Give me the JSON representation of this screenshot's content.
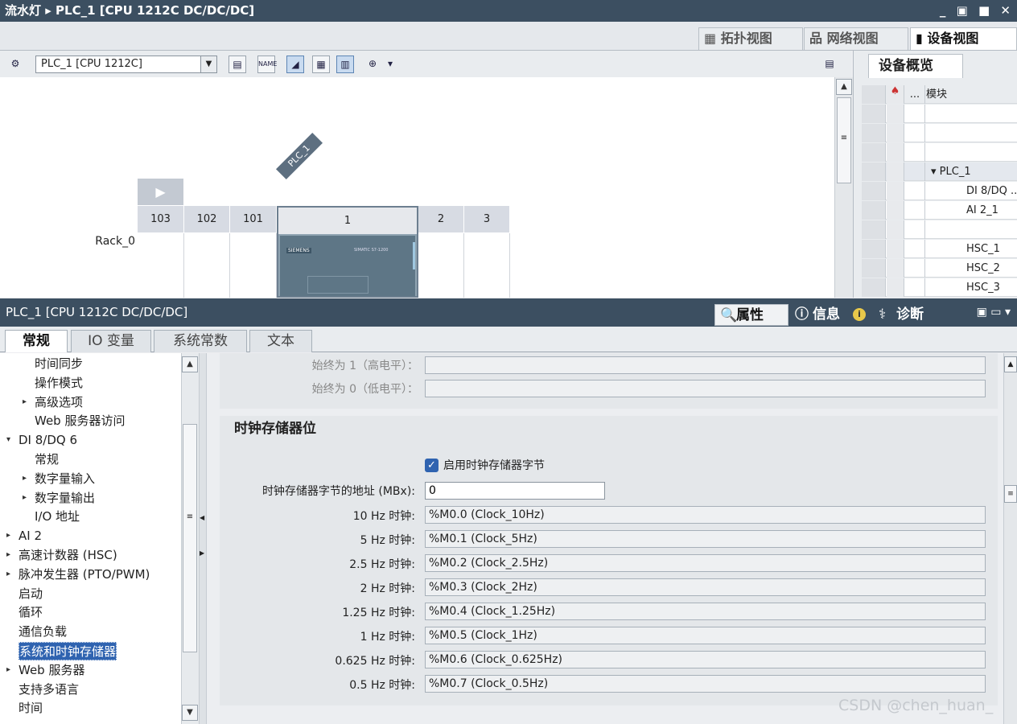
{
  "title_bar": {
    "project": "流水灯",
    "device": "PLC_1 [CPU 1212C DC/DC/DC]",
    "controls": "_ ▣ ■ ✕"
  },
  "view_tabs": [
    {
      "label": "拓扑视图",
      "icon": "topology-icon"
    },
    {
      "label": "网络视图",
      "icon": "network-icon"
    },
    {
      "label": "设备视图",
      "icon": "device-icon",
      "active": true
    }
  ],
  "toolbar": {
    "device_select": "PLC_1 [CPU 1212C]"
  },
  "canvas": {
    "plc_label": "PLC_1",
    "rack_label": "Rack_0",
    "slots": [
      "103",
      "102",
      "101",
      "1",
      "2",
      "3"
    ],
    "brand": "SIEMENS",
    "model": "SIMATIC S7-1200"
  },
  "overview": {
    "tab": "设备概览",
    "col_dots": "...",
    "col_module": "模块",
    "rows": [
      "",
      "",
      "",
      "PLC_1",
      "DI 8/DQ ...",
      "AI 2_1",
      "",
      "HSC_1",
      "HSC_2",
      "HSC_3"
    ]
  },
  "properties_bar": {
    "title": "PLC_1 [CPU 1212C DC/DC/DC]",
    "tabs": [
      {
        "label": "属性",
        "icon": "properties-icon"
      },
      {
        "label": "信息",
        "icon": "info-icon"
      },
      {
        "label": "诊断",
        "icon": "diagnostics-icon"
      }
    ],
    "info_badge": "i"
  },
  "sub_tabs": [
    "常规",
    "IO 变量",
    "系统常数",
    "文本"
  ],
  "nav": {
    "items": [
      {
        "label": "时间同步",
        "indent": 2,
        "expand": ""
      },
      {
        "label": "操作模式",
        "indent": 2,
        "expand": ""
      },
      {
        "label": "高级选项",
        "indent": 2,
        "expand": "▸"
      },
      {
        "label": "Web 服务器访问",
        "indent": 2,
        "expand": ""
      },
      {
        "label": "DI 8/DQ 6",
        "indent": 1,
        "expand": "▾"
      },
      {
        "label": "常规",
        "indent": 2,
        "expand": ""
      },
      {
        "label": "数字量输入",
        "indent": 2,
        "expand": "▸"
      },
      {
        "label": "数字量输出",
        "indent": 2,
        "expand": "▸"
      },
      {
        "label": "I/O 地址",
        "indent": 2,
        "expand": ""
      },
      {
        "label": "AI 2",
        "indent": 1,
        "expand": "▸"
      },
      {
        "label": "高速计数器 (HSC)",
        "indent": 1,
        "expand": "▸"
      },
      {
        "label": "脉冲发生器 (PTO/PWM)",
        "indent": 1,
        "expand": "▸"
      },
      {
        "label": "启动",
        "indent": 1,
        "expand": ""
      },
      {
        "label": "循环",
        "indent": 1,
        "expand": ""
      },
      {
        "label": "通信负载",
        "indent": 1,
        "expand": ""
      },
      {
        "label": "系统和时钟存储器",
        "indent": 1,
        "expand": "",
        "selected": true
      },
      {
        "label": "Web 服务器",
        "indent": 1,
        "expand": "▸"
      },
      {
        "label": "支持多语言",
        "indent": 1,
        "expand": ""
      },
      {
        "label": "时间",
        "indent": 1,
        "expand": ""
      }
    ]
  },
  "system_bits": {
    "always_1_label": "始终为 1（高电平）：",
    "always_0_label": "始终为 0（低电平）："
  },
  "clock_memory": {
    "section_title": "时钟存储器位",
    "enable_label": "启用时钟存储器字节",
    "enable_checked": true,
    "address_label": "时钟存储器字节的地址 (MBx):",
    "address_value": "0",
    "clocks": [
      {
        "label": "10 Hz 时钟:",
        "value": "%M0.0 (Clock_10Hz)"
      },
      {
        "label": "5 Hz 时钟:",
        "value": "%M0.1 (Clock_5Hz)"
      },
      {
        "label": "2.5 Hz 时钟:",
        "value": "%M0.2 (Clock_2.5Hz)"
      },
      {
        "label": "2 Hz 时钟:",
        "value": "%M0.3 (Clock_2Hz)"
      },
      {
        "label": "1.25 Hz 时钟:",
        "value": "%M0.4 (Clock_1.25Hz)"
      },
      {
        "label": "1 Hz 时钟:",
        "value": "%M0.5 (Clock_1Hz)"
      },
      {
        "label": "0.625 Hz 时钟:",
        "value": "%M0.6 (Clock_0.625Hz)"
      },
      {
        "label": "0.5 Hz 时钟:",
        "value": "%M0.7 (Clock_0.5Hz)"
      }
    ]
  },
  "watermark": "CSDN @chen_huan_",
  "colors": {
    "accent": "#2f63b0",
    "titlebar": "#3c4f61"
  }
}
